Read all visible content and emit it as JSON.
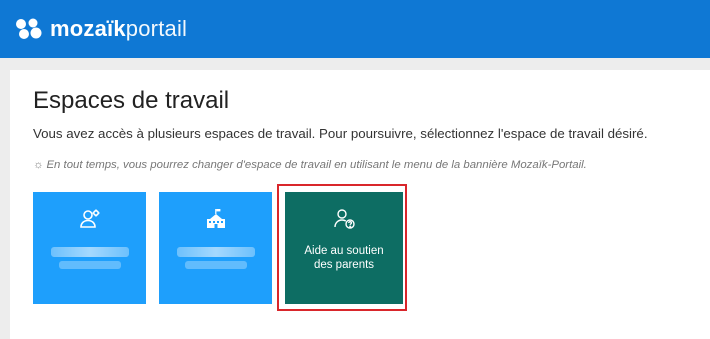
{
  "banner": {
    "logo_bold": "mozaïk",
    "logo_light": "portail",
    "color": "#0f78d4"
  },
  "main": {
    "title": "Espaces de travail",
    "subtitle": "Vous avez accès à plusieurs espaces de travail. Pour poursuivre, sélectionnez l'espace de travail désiré.",
    "hint": "En tout temps, vous pourrez changer d'espace de travail en utilisant le menu de la bannière Mozaïk-Portail.",
    "hint_icon": "lightbulb-icon"
  },
  "workspaces": [
    {
      "icon": "users-settings-icon",
      "label": "",
      "color": "#1e9ffc",
      "blurred": true
    },
    {
      "icon": "school-building-icon",
      "label": "",
      "color": "#1e9ffc",
      "blurred": true
    },
    {
      "icon": "person-help-icon",
      "label": "Aide au soutien des parents",
      "color": "#0d6d63",
      "highlighted": true
    }
  ],
  "colors": {
    "highlight": "#d9262b",
    "background": "#ededed"
  }
}
